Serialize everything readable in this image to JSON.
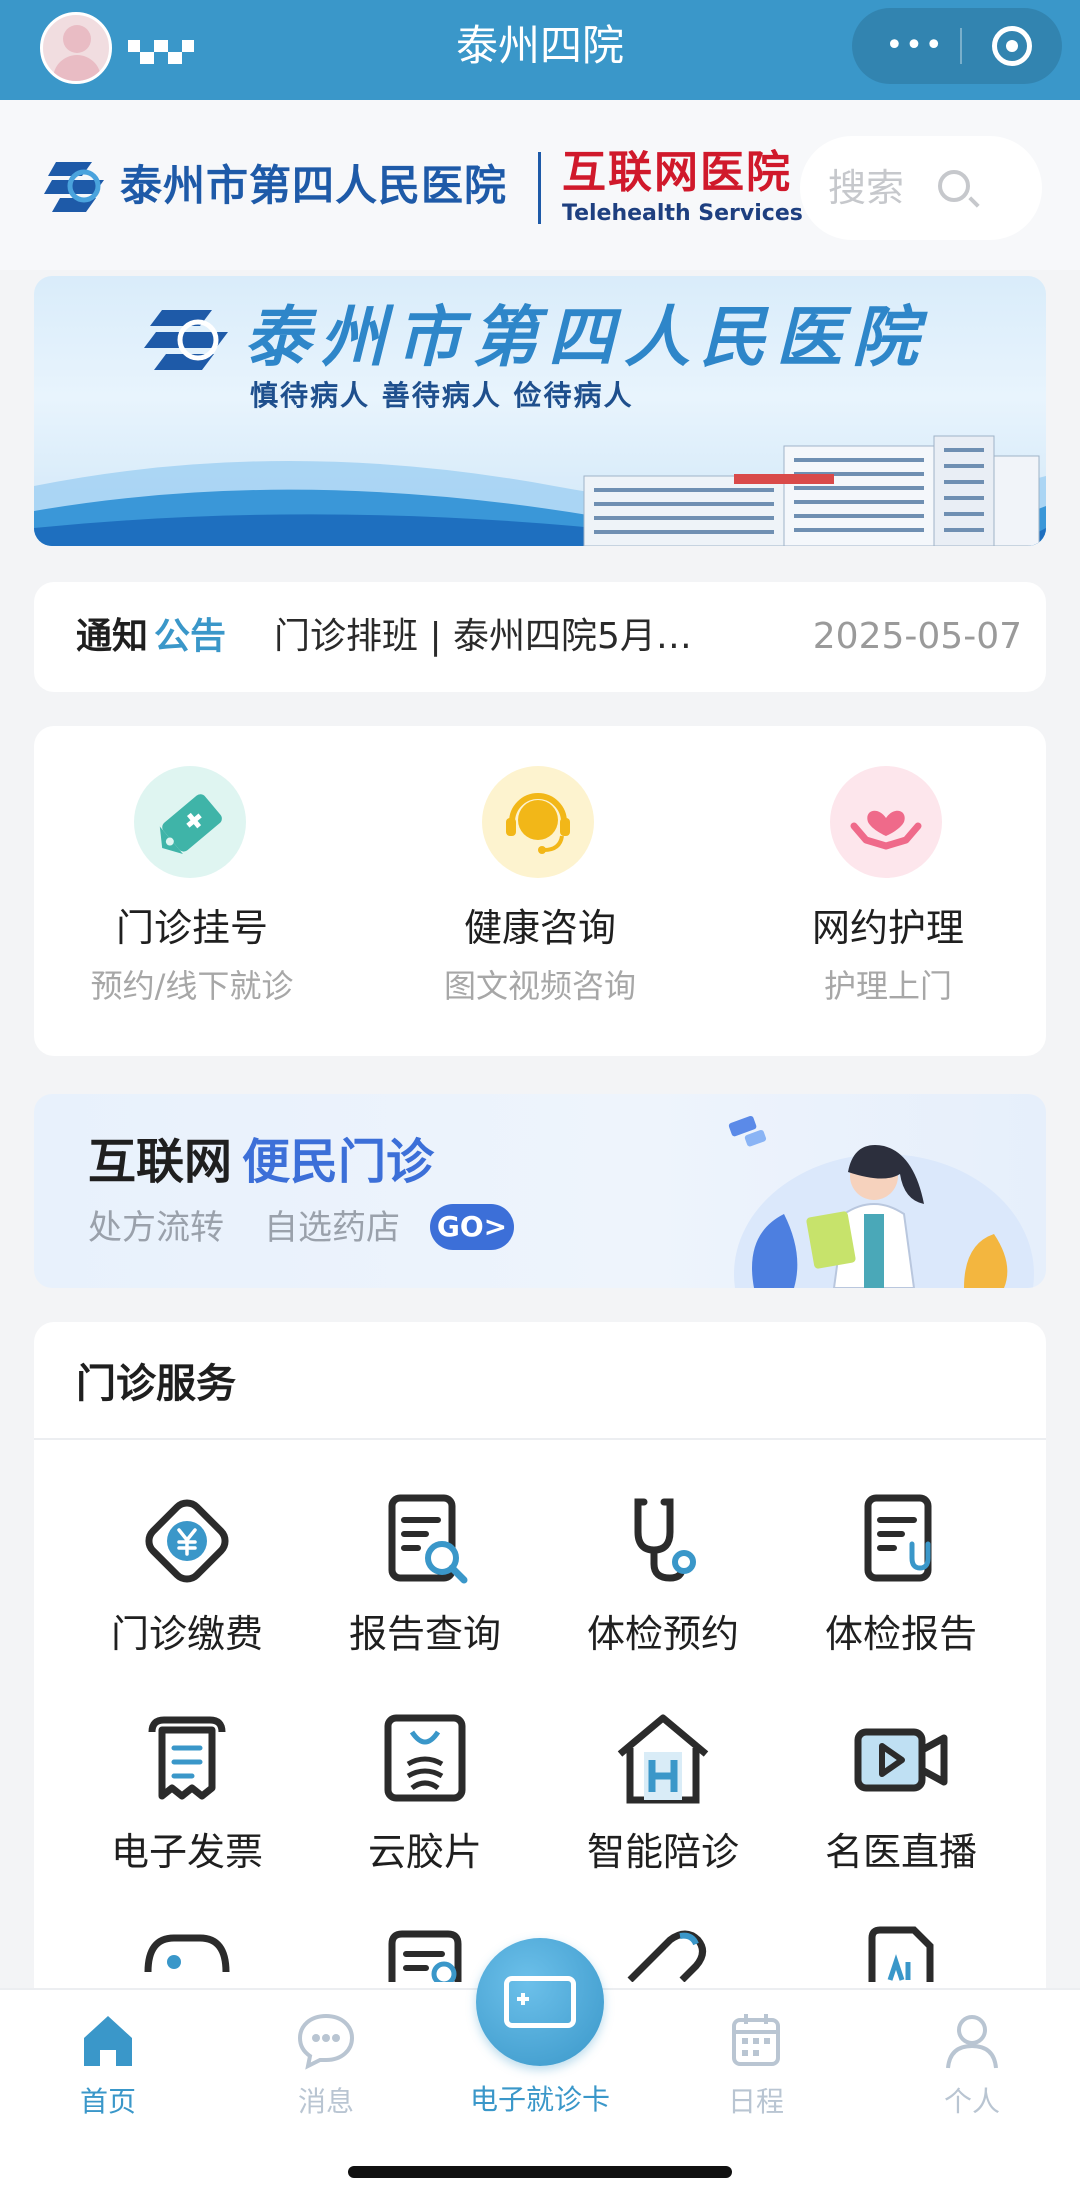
{
  "topbar": {
    "title": "泰州四院",
    "menu_glyph": "•••",
    "colors": {
      "bar": "#3a97c9"
    }
  },
  "header": {
    "hospital_name": "泰州市第四人民医院",
    "internet_hospital": "互联网医院",
    "internet_hospital_en": "Telehealth Services",
    "search_placeholder": "搜索"
  },
  "banner": {
    "title": "泰州市第四人民医院",
    "slogan": "慎待病人 善待病人 俭待病人"
  },
  "notice": {
    "label_a": "通知",
    "label_b": "公告",
    "text": "门诊排班 | 泰州四院5月…",
    "date": "2025-05-07"
  },
  "main_entries": [
    {
      "label": "门诊挂号",
      "sub": "预约/线下就诊",
      "icon": "price-tag-icon",
      "color": "#dff5f1"
    },
    {
      "label": "健康咨询",
      "sub": "图文视频咨询",
      "icon": "headset-icon",
      "color": "#fdf3cf"
    },
    {
      "label": "网约护理",
      "sub": "护理上门",
      "icon": "heart-hands-icon",
      "color": "#fde6ec"
    }
  ],
  "promo": {
    "title_a": "互联网",
    "title_b": "便民门诊",
    "sub_a": "处方流转",
    "sub_b": "自选药店",
    "go": "GO>"
  },
  "services": {
    "heading": "门诊服务",
    "items": [
      {
        "label": "门诊缴费",
        "icon": "yuan-payment-icon"
      },
      {
        "label": "报告查询",
        "icon": "report-search-icon"
      },
      {
        "label": "体检预约",
        "icon": "stethoscope-icon"
      },
      {
        "label": "体检报告",
        "icon": "exam-report-icon"
      },
      {
        "label": "电子发票",
        "icon": "receipt-icon"
      },
      {
        "label": "云胶片",
        "icon": "xray-film-icon"
      },
      {
        "label": "智能陪诊",
        "icon": "hospital-house-icon"
      },
      {
        "label": "名医直播",
        "icon": "video-camera-icon"
      }
    ]
  },
  "tabs": {
    "home": "首页",
    "messages": "消息",
    "card": "电子就诊卡",
    "schedule": "日程",
    "profile": "个人"
  }
}
